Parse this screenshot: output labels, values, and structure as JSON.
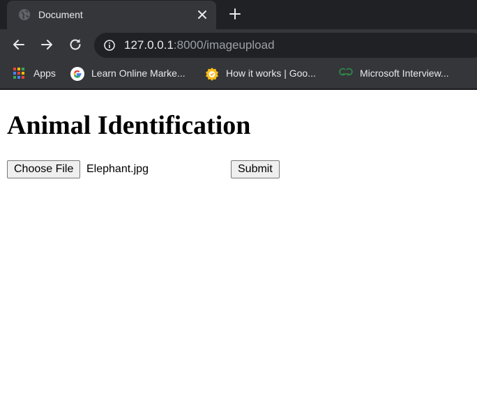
{
  "tab": {
    "title": "Document",
    "favicon_icon": "globe-icon",
    "close_icon": "close-icon",
    "new_tab_icon": "plus-icon"
  },
  "toolbar": {
    "back_icon": "arrow-left-icon",
    "forward_icon": "arrow-right-icon",
    "reload_icon": "reload-icon",
    "info_icon": "info-icon",
    "url_host": "127.0.0.1",
    "url_rest": ":8000/imageupload"
  },
  "bookmarks": [
    {
      "label": "Apps",
      "icon": "apps-grid-icon"
    },
    {
      "label": "Learn Online Marke...",
      "icon": "google-icon"
    },
    {
      "label": "How it works | Goo...",
      "icon": "badge-icon"
    },
    {
      "label": "Microsoft Interview...",
      "icon": "gfg-icon"
    }
  ],
  "page": {
    "heading": "Animal Identification",
    "choose_file_label": "Choose File",
    "file_name": "Elephant.jpg",
    "submit_label": "Submit"
  },
  "colors": {
    "chrome_dark": "#202124",
    "chrome_mid": "#35363a",
    "text_light": "#e8eaed",
    "text_muted": "#9aa0a6",
    "gfg_green": "#2f8d46"
  }
}
